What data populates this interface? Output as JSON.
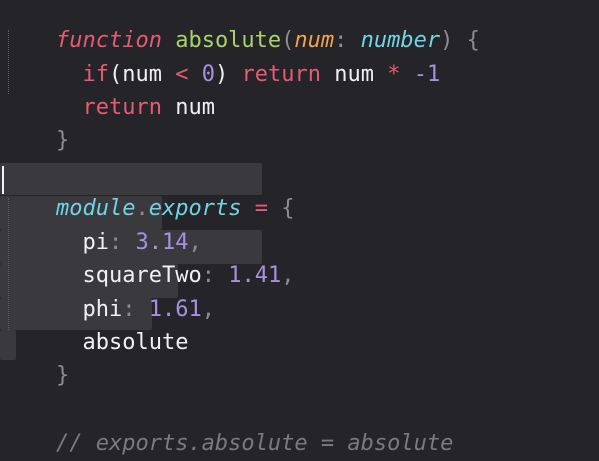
{
  "editor": {
    "language": "TypeScript",
    "lines": {
      "l1": {
        "keyword": "function",
        "name": "absolute",
        "open_paren": "(",
        "param": "num",
        "colon": ":",
        "type": "number",
        "close_paren": ")",
        "brace": "{"
      },
      "l2": {
        "if_kw": "if",
        "open_paren": "(",
        "var": "num",
        "op": "<",
        "num": "0",
        "close_paren": ")",
        "return_kw": "return",
        "var2": "num",
        "star": "*",
        "neg": "-1"
      },
      "l3": {
        "return_kw": "return",
        "var": "num"
      },
      "l4": {
        "brace": "}"
      },
      "l6": {
        "module": "module",
        "dot": ".",
        "exports": "exports",
        "eq": "=",
        "brace": "{"
      },
      "l7": {
        "key": "pi",
        "colon": ":",
        "value": "3.14",
        "comma": ","
      },
      "l8": {
        "key": "squareTwo",
        "colon": ":",
        "value": "1.41",
        "comma": ","
      },
      "l9": {
        "key": "phi",
        "colon": ":",
        "value": "1.61",
        "comma": ","
      },
      "l10": {
        "key": "absolute"
      },
      "l11": {
        "brace": "}"
      },
      "l13": {
        "comment": "// exports.absolute = absolute"
      }
    },
    "colors": {
      "background": "#252428",
      "selection": "#3a393e",
      "keyword": "#e65b74",
      "function": "#a6d46c",
      "param": "#f0a251",
      "type": "#6fd4e3",
      "number": "#a890e0",
      "comment": "#7c7980"
    }
  }
}
